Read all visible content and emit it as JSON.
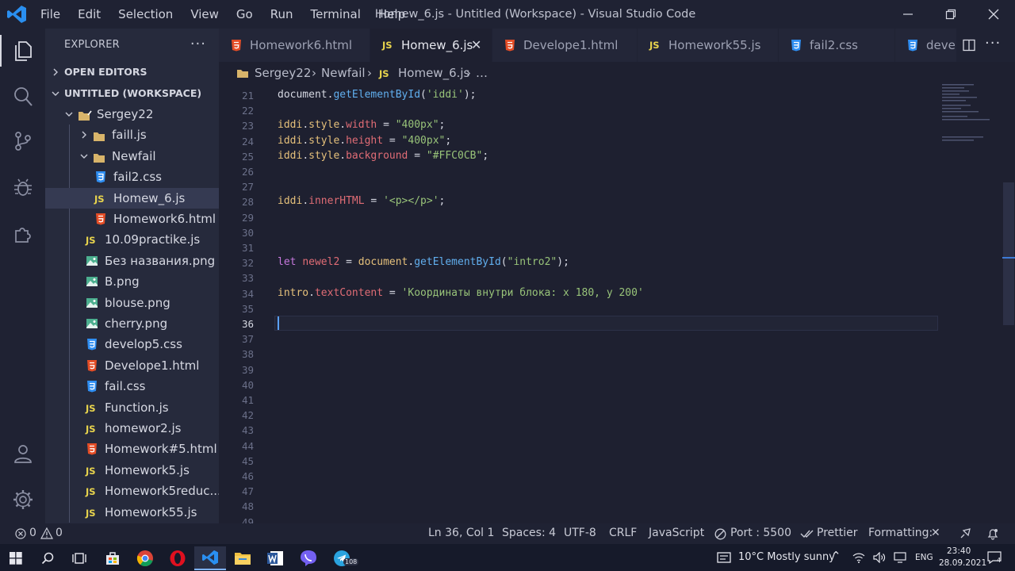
{
  "window": {
    "title": "Homew_6.js - Untitled (Workspace) - Visual Studio Code"
  },
  "menu": [
    "File",
    "Edit",
    "Selection",
    "View",
    "Go",
    "Run",
    "Terminal",
    "Help"
  ],
  "sidebar": {
    "title": "EXPLORER",
    "more": "···",
    "sections": {
      "open_editors": "OPEN EDITORS",
      "workspace": "UNTITLED (WORKSPACE)"
    },
    "tree": [
      {
        "label": "Sergey22",
        "type": "folder-root",
        "expanded": true
      },
      {
        "label": "faill.js",
        "type": "folder",
        "expanded": false
      },
      {
        "label": "Newfail",
        "type": "folder",
        "expanded": true
      },
      {
        "label": "fail2.css",
        "type": "css"
      },
      {
        "label": "Homew_6.js",
        "type": "js",
        "selected": true
      },
      {
        "label": "Homework6.html",
        "type": "html"
      },
      {
        "label": "10.09practike.js",
        "type": "js"
      },
      {
        "label": "Без названия.png",
        "type": "png"
      },
      {
        "label": "B.png",
        "type": "png"
      },
      {
        "label": "blouse.png",
        "type": "png"
      },
      {
        "label": "cherry.png",
        "type": "png"
      },
      {
        "label": "develop5.css",
        "type": "css"
      },
      {
        "label": "Develope1.html",
        "type": "html"
      },
      {
        "label": "fail.css",
        "type": "css"
      },
      {
        "label": "Function.js",
        "type": "js"
      },
      {
        "label": "homewor2.js",
        "type": "js"
      },
      {
        "label": "Homework#5.html",
        "type": "html"
      },
      {
        "label": "Homework5.js",
        "type": "js"
      },
      {
        "label": "Homework5reduc...",
        "type": "js"
      },
      {
        "label": "Homework55.js",
        "type": "js"
      }
    ]
  },
  "tabs": [
    {
      "label": "Homework6.html",
      "type": "html"
    },
    {
      "label": "Homew_6.js",
      "type": "js",
      "active": true,
      "close": "✕"
    },
    {
      "label": "Develope1.html",
      "type": "html"
    },
    {
      "label": "Homework55.js",
      "type": "js"
    },
    {
      "label": "fail2.css",
      "type": "css"
    },
    {
      "label": "devel",
      "type": "css"
    }
  ],
  "js_badge": "JS",
  "breadcrumb": {
    "folder": "Sergey22",
    "sep": "›",
    "sub": "Newfail",
    "file": "Homew_6.js",
    "tail": "…"
  },
  "editor": {
    "current_line": 36,
    "lines": [
      {
        "n": "21",
        "tokens": [
          [
            "plain",
            "document."
          ],
          [
            "fn",
            "getElementById"
          ],
          [
            "plain",
            "("
          ],
          [
            "str",
            "'iddi'"
          ],
          [
            "plain",
            ");"
          ]
        ]
      },
      {
        "n": "22",
        "tokens": []
      },
      {
        "n": "23",
        "tokens": [
          [
            "var",
            "iddi"
          ],
          [
            "plain",
            "."
          ],
          [
            "var",
            "style"
          ],
          [
            "plain",
            "."
          ],
          [
            "prop",
            "width"
          ],
          [
            "plain",
            " = "
          ],
          [
            "str",
            "\"400px\""
          ],
          [
            "plain",
            ";"
          ]
        ]
      },
      {
        "n": "24",
        "tokens": [
          [
            "var",
            "iddi"
          ],
          [
            "plain",
            "."
          ],
          [
            "var",
            "style"
          ],
          [
            "plain",
            "."
          ],
          [
            "prop",
            "height"
          ],
          [
            "plain",
            " = "
          ],
          [
            "str",
            "\"400px\""
          ],
          [
            "plain",
            ";"
          ]
        ]
      },
      {
        "n": "25",
        "tokens": [
          [
            "var",
            "iddi"
          ],
          [
            "plain",
            "."
          ],
          [
            "var",
            "style"
          ],
          [
            "plain",
            "."
          ],
          [
            "prop",
            "background"
          ],
          [
            "plain",
            " = "
          ],
          [
            "str",
            "\"#FFC0CB\""
          ],
          [
            "plain",
            ";"
          ]
        ]
      },
      {
        "n": "26",
        "tokens": []
      },
      {
        "n": "27",
        "tokens": []
      },
      {
        "n": "28",
        "tokens": [
          [
            "var",
            "iddi"
          ],
          [
            "plain",
            "."
          ],
          [
            "prop",
            "innerHTML"
          ],
          [
            "plain",
            " = "
          ],
          [
            "str",
            "'<p></p>'"
          ],
          [
            "plain",
            ";"
          ]
        ]
      },
      {
        "n": "29",
        "tokens": []
      },
      {
        "n": "30",
        "tokens": []
      },
      {
        "n": "31",
        "tokens": []
      },
      {
        "n": "32",
        "tokens": [
          [
            "kw",
            "let "
          ],
          [
            "prop",
            "newel2"
          ],
          [
            "plain",
            " = "
          ],
          [
            "var",
            "document"
          ],
          [
            "plain",
            "."
          ],
          [
            "fn",
            "getElementById"
          ],
          [
            "plain",
            "("
          ],
          [
            "str",
            "\"intro2\""
          ],
          [
            "plain",
            ");"
          ]
        ]
      },
      {
        "n": "33",
        "tokens": []
      },
      {
        "n": "34",
        "tokens": [
          [
            "var",
            "intro"
          ],
          [
            "plain",
            "."
          ],
          [
            "prop",
            "textContent"
          ],
          [
            "plain",
            " = "
          ],
          [
            "str",
            "'Координаты внутри блока: x 180, y 200'"
          ]
        ]
      },
      {
        "n": "35",
        "tokens": []
      },
      {
        "n": "36",
        "tokens": []
      },
      {
        "n": "37",
        "tokens": []
      },
      {
        "n": "38",
        "tokens": []
      },
      {
        "n": "39",
        "tokens": []
      },
      {
        "n": "40",
        "tokens": []
      },
      {
        "n": "41",
        "tokens": []
      },
      {
        "n": "42",
        "tokens": []
      },
      {
        "n": "43",
        "tokens": []
      },
      {
        "n": "44",
        "tokens": []
      },
      {
        "n": "45",
        "tokens": []
      },
      {
        "n": "46",
        "tokens": []
      },
      {
        "n": "47",
        "tokens": []
      },
      {
        "n": "48",
        "tokens": []
      },
      {
        "n": "49",
        "tokens": []
      }
    ]
  },
  "statusbar": {
    "errors": "0",
    "warnings": "0",
    "position": "Ln 36, Col 1",
    "spaces": "Spaces: 4",
    "encoding": "UTF-8",
    "eol": "CRLF",
    "language": "JavaScript",
    "port": "Port : 5500",
    "prettier": "Prettier",
    "formatting": "Formatting:",
    "formatting_x": "✕"
  },
  "taskbar": {
    "weather": "10°C  Mostly sunny",
    "lang": "ENG",
    "time": "23:40",
    "date": "28.09.2021",
    "telegram_badge": "108",
    "notif_count": "4"
  },
  "colors": {
    "accent": "#007acc",
    "js": "#e8d44d",
    "html": "#e44d26",
    "css": "#2f8ef2",
    "png": "#4caf8f",
    "folder": "#d8b46a"
  }
}
